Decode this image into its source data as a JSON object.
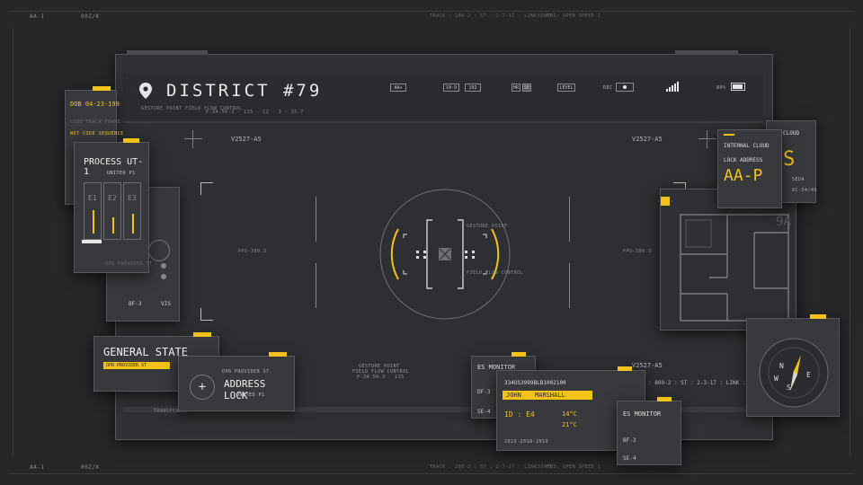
{
  "frame": {
    "corner_left_label": "AA-1",
    "corner_left_code": "00Z/K",
    "track_text": "TRACK : 208-2 : ST : 2-7-17 : LINK : HF",
    "status_text": "STATUS: OPEN SPEED 1"
  },
  "main": {
    "title": "DISTRICT #79",
    "location_icon": "map-pin-icon",
    "sub_line_1": "GESTURE POINT FIELD FLOW CONTROL",
    "sub_line_2": "P-34.56-3 · 115 · 12 · 3 · 15-7",
    "toolbar": {
      "btn_a": "AA+",
      "btn_b": "10-9",
      "btn_c": "192",
      "btn_d": "HR",
      "btn_e": "SE",
      "btn_level": "LEVEL",
      "rec_label": "REC",
      "battery_pct": "80%"
    },
    "coord_left": "V2527-A5",
    "coord_right": "V2527-A5",
    "coord_bottom_right": "V2527-A5",
    "ppo_left": "PPO-380.3",
    "ppo_right": "PPO-380.3",
    "center_label_top": "GESTURE POINT",
    "center_label_mid": "FIELD FLOW CONTROL",
    "center_label_bot": "P-34.56-3 · 115",
    "file_line": "FILE : 809-2 : ST : 2-3-17 : LINK : HF",
    "footer_left": "TRANSFERRED",
    "footer_mid": "45"
  },
  "panel_dob": {
    "title": "DOB 04-23-199",
    "line1": "CODE TRACK FRAME",
    "line2": "NOT CODE SEQUENCE"
  },
  "panel_process": {
    "title": "PROCESS UT-1",
    "subtitle": "UNITED P1",
    "slots": [
      "E1",
      "E2",
      "E3"
    ],
    "footer": "OPR PROVIDER ST"
  },
  "panel_bf": {
    "code": "BF-3",
    "code2": "VIS"
  },
  "panel_general": {
    "title": "GENERAL STATE",
    "sub": "OPR PROVIDER ST"
  },
  "panel_address": {
    "small": "OPR PROVIDER ST.",
    "title": "ADDRESS LOCK",
    "sub": "UNITED P1"
  },
  "panel_es_small": {
    "title": "ES MONITOR",
    "code1": "DF-3",
    "code2": "SE-4"
  },
  "panel_id": {
    "number": "334US3999BLB1002100",
    "first": "JOHN",
    "last": "MARSHALL",
    "id_code": "ID : E4",
    "temp1": "14°C",
    "temp2": "21°C",
    "date": "2023-2018-2010"
  },
  "panel_es_monitor": {
    "title": "ES MONITOR",
    "code1": "BF-3",
    "code2": "SE-4"
  },
  "panel_cloud": {
    "title": "INTERNAL CLOUD",
    "title2": "CLOUD",
    "label": "LOCK ADDRESS",
    "big": "AA-P",
    "big2": "S",
    "val1": "SEDA",
    "val2": "XC-54/45"
  },
  "panel_map": {
    "label": "9A"
  },
  "panel_compass": {
    "n": "N",
    "e": "E",
    "s": "S",
    "w": "W"
  },
  "colors": {
    "accent": "#f2c21b",
    "bg": "#262729",
    "panel": "#38393c"
  }
}
